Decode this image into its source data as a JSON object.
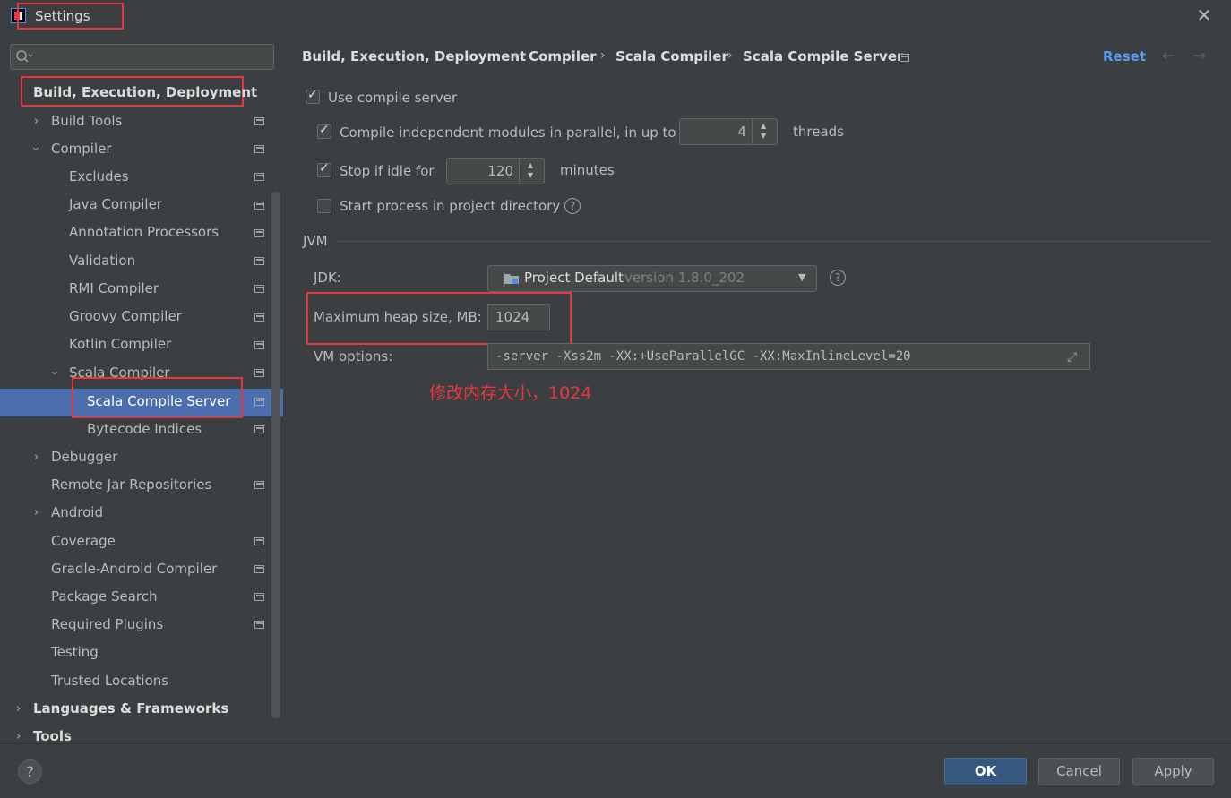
{
  "window": {
    "title": "Settings"
  },
  "sidebar": {
    "search_placeholder": "",
    "section_title": "Build, Execution, Deployment",
    "items": [
      {
        "label": "Build Tools"
      },
      {
        "label": "Compiler"
      },
      {
        "label": "Excludes"
      },
      {
        "label": "Java Compiler"
      },
      {
        "label": "Annotation Processors"
      },
      {
        "label": "Validation"
      },
      {
        "label": "RMI Compiler"
      },
      {
        "label": "Groovy Compiler"
      },
      {
        "label": "Kotlin Compiler"
      },
      {
        "label": "Scala Compiler"
      },
      {
        "label": "Scala Compile Server"
      },
      {
        "label": "Bytecode Indices"
      },
      {
        "label": "Debugger"
      },
      {
        "label": "Remote Jar Repositories"
      },
      {
        "label": "Android"
      },
      {
        "label": "Coverage"
      },
      {
        "label": "Gradle-Android Compiler"
      },
      {
        "label": "Package Search"
      },
      {
        "label": "Required Plugins"
      },
      {
        "label": "Testing"
      },
      {
        "label": "Trusted Locations"
      }
    ],
    "groups": [
      {
        "label": "Languages & Frameworks"
      },
      {
        "label": "Tools"
      }
    ]
  },
  "breadcrumb": {
    "items": [
      "Build, Execution, Deployment",
      "Compiler",
      "Scala Compiler",
      "Scala Compile Server"
    ],
    "separator": "›",
    "reset_label": "Reset",
    "back_icon": "←",
    "forward_icon": "→"
  },
  "form": {
    "use_compile_server": {
      "label": "Use compile server",
      "checked": true
    },
    "parallel": {
      "label": "Compile independent modules in parallel, in up to",
      "value": "4",
      "suffix": "threads",
      "checked": true
    },
    "stop_idle": {
      "label": "Stop if idle for",
      "value": "120",
      "suffix": "minutes",
      "checked": true
    },
    "start_process": {
      "label": "Start process in project directory",
      "checked": false
    },
    "jvm_section": "JVM",
    "jdk": {
      "label": "JDK:",
      "name": "Project Default",
      "version": "version 1.8.0_202"
    },
    "heap": {
      "label": "Maximum heap size, MB:",
      "value": "1024"
    },
    "vm_options": {
      "label": "VM options:",
      "value": "-server -Xss2m -XX:+UseParallelGC -XX:MaxInlineLevel=20"
    },
    "annotation": "修改内存大小，1024"
  },
  "footer": {
    "help": "?",
    "ok": "OK",
    "cancel": "Cancel",
    "apply": "Apply"
  },
  "colors": {
    "background": "#3c3f41",
    "selection": "#4b6eaf",
    "accent_link": "#589df6",
    "annotation_red": "#e8383d",
    "ok_button": "#365880"
  }
}
